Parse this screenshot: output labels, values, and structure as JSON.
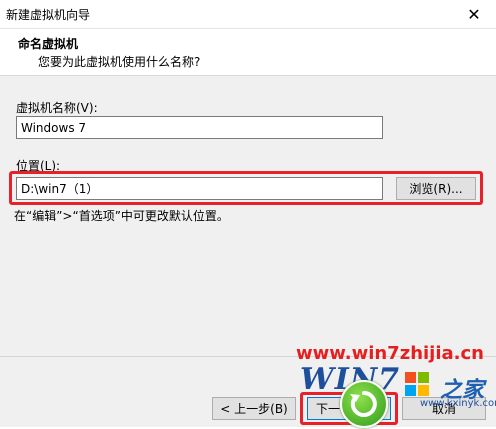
{
  "window": {
    "title": "新建虚拟机向导",
    "close_glyph": "✕"
  },
  "header": {
    "title": "命名虚拟机",
    "subtitle": "您要为此虚拟机使用什么名称?"
  },
  "form": {
    "vm_name_label": "虚拟机名称(V):",
    "vm_name_value": "Windows 7",
    "location_label": "位置(L):",
    "location_value": "D:\\win7（1）",
    "browse_label": "浏览(R)...",
    "hint": "在“编辑”>“首选项”中可更改默认位置。"
  },
  "footer": {
    "back_label": "< 上一步(B)",
    "next_label": "下一",
    "cancel_label": "取消"
  },
  "watermark": {
    "url": "www.win7zhijia.cn",
    "logo_text": "WIN7",
    "cn_text": "之家",
    "site": "www.kxinyk.com"
  },
  "colors": {
    "highlight": "#e8202a",
    "watermark_red": "#e51f1f",
    "watermark_blue": "#1d4f9c"
  }
}
